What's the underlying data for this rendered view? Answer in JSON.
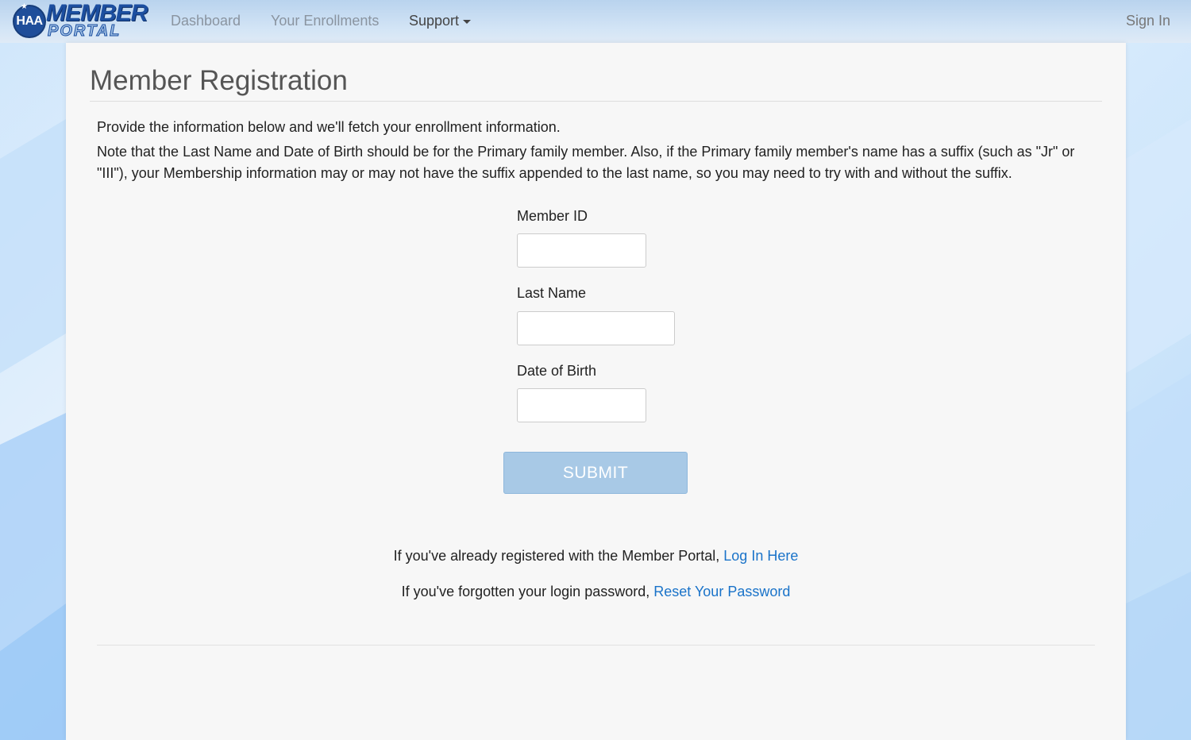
{
  "nav": {
    "logo_badge": "HAA",
    "logo_word1": "MEMBER",
    "logo_word2": "PORTAL",
    "links": {
      "dashboard": "Dashboard",
      "enrollments": "Your Enrollments",
      "support": "Support"
    },
    "signin": "Sign In"
  },
  "page": {
    "title": "Member Registration",
    "intro": "Provide the information below and we'll fetch your enrollment information.",
    "note": "Note that the Last Name and Date of Birth should be for the Primary family member. Also, if the Primary family member's name has a suffix (such as \"Jr\" or \"III\"), your Membership information may or may not have the suffix appended to the last name, so you may need to try with and without the suffix."
  },
  "form": {
    "member_id_label": "Member ID",
    "member_id_value": "",
    "last_name_label": "Last Name",
    "last_name_value": "",
    "dob_label": "Date of Birth",
    "dob_value": "",
    "submit_label": "SUBMIT"
  },
  "footer_links": {
    "login_prefix": "If you've already registered with the Member Portal, ",
    "login_link": "Log In Here",
    "reset_prefix": "If you've forgotten your login password, ",
    "reset_link": "Reset Your Password"
  },
  "colors": {
    "link": "#1a73c9",
    "submit_disabled": "#a8c9e6",
    "logo_blue": "#1c4fa0"
  }
}
